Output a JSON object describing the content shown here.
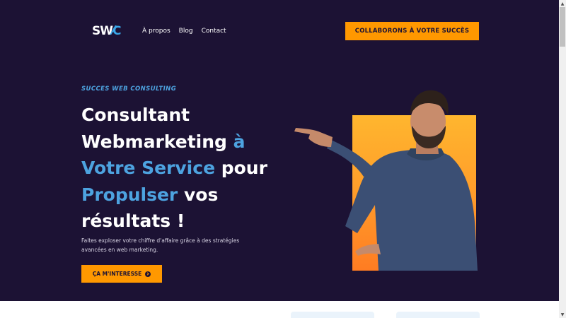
{
  "header": {
    "logo_text_main": "SW",
    "logo_text_accent": "C",
    "nav": [
      {
        "label": "À propos"
      },
      {
        "label": "Blog"
      },
      {
        "label": "Contact"
      }
    ],
    "cta_label": "COLLABORONS À VOTRE SUCCÈS"
  },
  "hero": {
    "eyebrow": "SUCCES WEB CONSULTING",
    "headline": {
      "p1": "Consultant",
      "p2": "Webmarketing ",
      "p3": "à",
      "p4": "Votre Service",
      "p5": " pour",
      "p6": "Propulser",
      "p7": " vos",
      "p8": "résultats !"
    },
    "subtext": "Faites exploser votre chiffre d'affaire grâce à des stratégies avancées en web marketing.",
    "cta_label": "ÇA M'INTERESSE"
  },
  "colors": {
    "background": "#1c1234",
    "accent": "#ff9800",
    "highlight": "#4da3e0"
  },
  "icons": {
    "cta_arrow": "arrow-circle-icon",
    "scroll_up": "chevron-up-icon",
    "scroll_down": "chevron-down-icon"
  }
}
